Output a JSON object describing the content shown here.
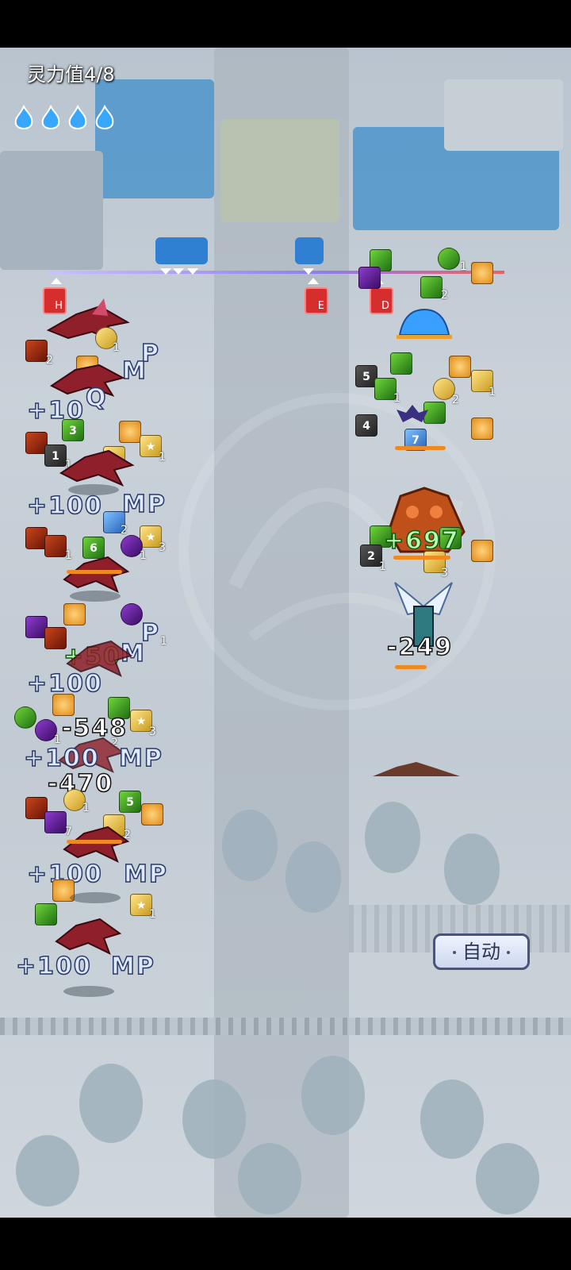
{
  "hud": {
    "spirit_label": "灵力值4/8",
    "spirit_icons": [
      "flame-icon",
      "flame-icon",
      "flame-icon",
      "flame-icon"
    ]
  },
  "timeline": {
    "enemies": [
      {
        "label": "H"
      },
      {
        "label": "E"
      },
      {
        "label": "D"
      }
    ]
  },
  "left_team": {
    "buff_counts": [
      "2",
      "1",
      "2",
      "1",
      "1",
      "2",
      "3",
      "1",
      "1",
      "1",
      "1",
      "3",
      "2",
      "1",
      "2",
      "1",
      "1",
      "2",
      "2",
      "1",
      "1",
      "7",
      "1",
      "2"
    ],
    "buff_numbers": [
      "3",
      "1",
      "6",
      "5"
    ],
    "combat_text": [
      {
        "text": "P"
      },
      {
        "text": "M"
      },
      {
        "text": "Q"
      },
      {
        "text": "+10"
      },
      {
        "text": "+100"
      },
      {
        "text": "MP"
      },
      {
        "text": "P"
      },
      {
        "text": "M"
      },
      {
        "text": "+50"
      },
      {
        "text": "+100"
      },
      {
        "text": "-548"
      },
      {
        "text": "+100"
      },
      {
        "text": "MP"
      },
      {
        "text": "-470"
      },
      {
        "text": "+100"
      },
      {
        "text": "MP"
      },
      {
        "text": "+100"
      },
      {
        "text": "MP"
      }
    ]
  },
  "right_team": {
    "buff_counts": [
      "1",
      "2",
      "1",
      "1",
      "2",
      "1",
      "3"
    ],
    "buff_numbers": [
      "3",
      "5",
      "4",
      "7",
      "2",
      "3"
    ],
    "combat_text": [
      {
        "text": "+697"
      },
      {
        "text": "-249"
      }
    ]
  },
  "controls": {
    "auto_label": "自动"
  },
  "colors": {
    "mp_text": "#dfe8ff",
    "damage_text": "#ffffff",
    "heal_text": "#b8ffb0",
    "enemy_tag": "#d62d2d",
    "ally_tag": "#2f7fd2"
  }
}
